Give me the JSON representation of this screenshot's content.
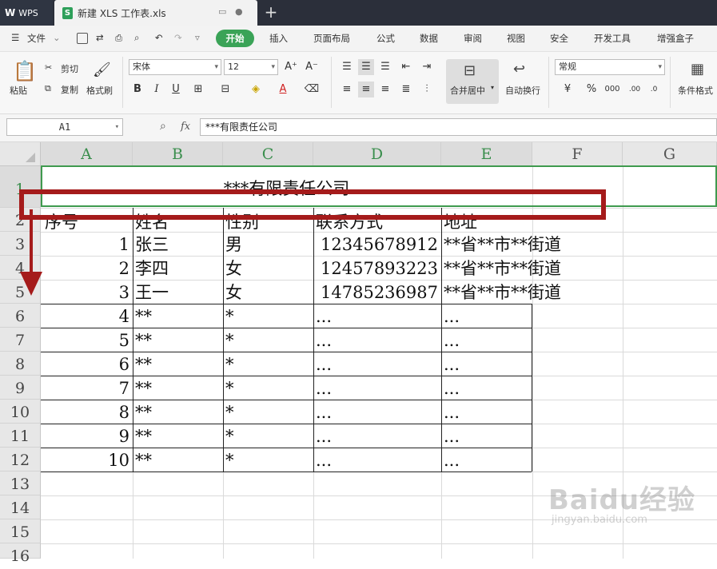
{
  "titlebar": {
    "app_label": "WPS",
    "file_tab_title": "新建 XLS 工作表.xls",
    "new_tab_symbol": "+"
  },
  "menubar": {
    "file_label": "文件",
    "tabs": [
      "开始",
      "插入",
      "页面布局",
      "公式",
      "数据",
      "审阅",
      "视图",
      "安全",
      "开发工具",
      "增强盒子"
    ]
  },
  "ribbon": {
    "paste_label": "粘贴",
    "cut_label": "剪切",
    "copy_label": "复制",
    "format_painter_label": "格式刷",
    "font_name": "宋体",
    "font_size": "12",
    "merge_center_label": "合并居中",
    "wrap_text_label": "自动换行",
    "number_format": "常规",
    "conditional_format_label": "条件格式"
  },
  "formula_bar": {
    "name_box": "A1",
    "fx_label": "fx",
    "content": "***有限责任公司"
  },
  "sheet": {
    "columns": [
      "A",
      "B",
      "C",
      "D",
      "E",
      "F",
      "G"
    ],
    "rows": [
      "1",
      "2",
      "3",
      "4",
      "5",
      "6",
      "7",
      "8",
      "9",
      "10",
      "11",
      "12",
      "13",
      "14",
      "15",
      "16"
    ],
    "title": "***有限责任公司",
    "headers": [
      "序号",
      "姓名",
      "性别",
      "联系方式",
      "地址"
    ],
    "data_rows": [
      [
        "1",
        "张三",
        "男",
        "12345678912",
        "**省**市**街道"
      ],
      [
        "2",
        "李四",
        "女",
        "12457893223",
        "**省**市**街道"
      ],
      [
        "3",
        "王一",
        "女",
        "14785236987",
        "**省**市**街道"
      ],
      [
        "4",
        "**",
        "*",
        "...",
        "..."
      ],
      [
        "5",
        "**",
        "*",
        "...",
        "..."
      ],
      [
        "6",
        "**",
        "*",
        "...",
        "..."
      ],
      [
        "7",
        "**",
        "*",
        "...",
        "..."
      ],
      [
        "8",
        "**",
        "*",
        "...",
        "..."
      ],
      [
        "9",
        "**",
        "*",
        "...",
        "..."
      ],
      [
        "10",
        "**",
        "*",
        "...",
        "..."
      ]
    ]
  },
  "watermark": {
    "brand": "Baidu经验",
    "url": "jingyan.baidu.com"
  },
  "colors": {
    "accent_green": "#3aa357",
    "annotation_red": "#a51b1b",
    "titlebar_dark": "#2b2f3a"
  }
}
